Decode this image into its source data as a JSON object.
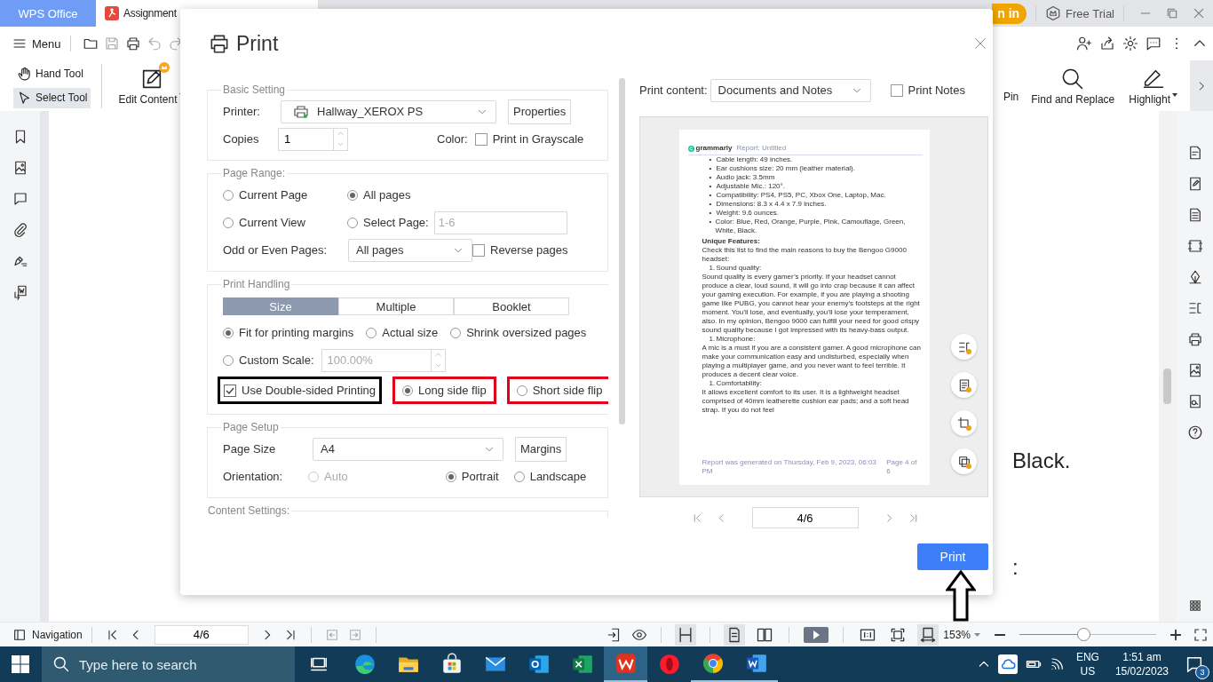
{
  "app_tabs": [
    {
      "label": "WPS Office",
      "kind": "home",
      "selected": false
    },
    {
      "label": "Assignment",
      "kind": "pdf",
      "selected": true
    }
  ],
  "account": {
    "sign_in": "n in",
    "free_trial": "Free Trial"
  },
  "toolbar": {
    "menu": "Menu",
    "tools": [
      {
        "label": "Hand Tool",
        "kind": "hand",
        "selected": false
      },
      {
        "label": "Select Tool",
        "kind": "select",
        "selected": true
      }
    ],
    "edit_content": "Edit Content",
    "pin": "Pin",
    "find_replace": "Find and Replace",
    "highlight": "Highlight"
  },
  "document": {
    "texts": [
      "Black.",
      ":"
    ]
  },
  "dialog": {
    "title": "Print",
    "basic": {
      "legend": "Basic Setting",
      "printer_label": "Printer:",
      "printer": "Hallway_XEROX PS",
      "properties": "Properties",
      "copies_label": "Copies",
      "copies": "1",
      "color_label": "Color:",
      "grayscale": {
        "label": "Print in Grayscale",
        "checked": false
      }
    },
    "page_range": {
      "legend": "Page Range:",
      "options": [
        {
          "label": "Current Page",
          "selected": false
        },
        {
          "label": "All pages",
          "selected": true
        },
        {
          "label": "Current View",
          "selected": false
        },
        {
          "label": "Select Page:",
          "selected": false
        }
      ],
      "select_page_placeholder": "1-6",
      "odd_even_label": "Odd or Even Pages:",
      "odd_even": "All pages",
      "reverse": {
        "label": "Reverse pages",
        "checked": false
      }
    },
    "handling": {
      "legend": "Print Handling",
      "tabs": [
        {
          "label": "Size",
          "selected": true
        },
        {
          "label": "Multiple",
          "selected": false
        },
        {
          "label": "Booklet",
          "selected": false
        }
      ],
      "scales": [
        {
          "label": "Fit for printing margins",
          "selected": true
        },
        {
          "label": "Actual size",
          "selected": false
        },
        {
          "label": "Shrink oversized pages",
          "selected": false
        },
        {
          "label": "Custom Scale:",
          "selected": false
        }
      ],
      "custom_scale": {
        "value": "100.00%",
        "disabled": true
      },
      "double_sided": {
        "label": "Use Double-sided Printing",
        "checked": true
      },
      "flips": [
        {
          "label": "Long side flip",
          "selected": true
        },
        {
          "label": "Short side flip",
          "selected": false
        }
      ]
    },
    "page_setup": {
      "legend": "Page Setup",
      "page_size_label": "Page Size",
      "page_size": "A4",
      "margins": "Margins",
      "orientation_label": "Orientation:",
      "orientations": [
        {
          "label": "Auto",
          "selected": false,
          "disabled": true
        },
        {
          "label": "Portrait",
          "selected": true,
          "disabled": false
        },
        {
          "label": "Landscape",
          "selected": false,
          "disabled": false
        }
      ]
    },
    "content_settings": {
      "legend": "Content Settings:"
    },
    "print_content_label": "Print content:",
    "print_content": "Documents and Notes",
    "print_notes": {
      "label": "Print Notes",
      "checked": false
    },
    "preview": {
      "logo": "grammarly",
      "header": "Report: Untitled",
      "blocks": [
        {
          "kind": "bullet",
          "marker": "•",
          "text": "Cable length: 49 inches."
        },
        {
          "kind": "bullet",
          "marker": "•",
          "text": "Ear cushions size: 20 mm (leather material)."
        },
        {
          "kind": "bullet",
          "marker": "•",
          "text": "Audio jack: 3.5mm"
        },
        {
          "kind": "bullet",
          "marker": "•",
          "text": "Adjustable Mic.: 120°."
        },
        {
          "kind": "bullet",
          "marker": "•",
          "text": "Compatibility: PS4, PS5, PC, Xbox One, Laptop, Mac."
        },
        {
          "kind": "bullet",
          "marker": "•",
          "text": "Dimensions: 8.3 x 4.4 x 7.9 inches."
        },
        {
          "kind": "bullet",
          "marker": "•",
          "text": "Weight: 9.6 ounces."
        },
        {
          "kind": "bullet",
          "marker": "•",
          "text": "Color: Blue, Red, Orange, Purple, Pink, Camouflage, Green, White, Black."
        },
        {
          "kind": "heading",
          "text": "Unique Features:"
        },
        {
          "kind": "para",
          "text": "Check this list to find the main reasons to buy the Bengoo G9000 headset:"
        },
        {
          "kind": "numbered",
          "marker": "1.",
          "text": "Sound quality:"
        },
        {
          "kind": "para",
          "text": "Sound quality is every gamer’s priority. If your headset cannot produce a clear, loud sound, it will go into crap because it can affect your gaming execution. For example, if you are playing a shooting game like PUBG, you cannot hear your enemy’s footsteps at the right moment. You’ll lose, and eventually, you’ll lose your temperament, also. In my opinion, Bengoo 9000 can fulfill your need for good crispy sound quality because I got impressed with its heavy-bass output."
        },
        {
          "kind": "numbered",
          "marker": "1.",
          "text": "Microphone:"
        },
        {
          "kind": "para",
          "text": "A mic is a must if you are a consistent gamer. A good microphone can make your communication easy and undisturbed, especially when playing a multiplayer game, and you never want to feel terrible. It produces a decent clear voice."
        },
        {
          "kind": "numbered",
          "marker": "1.",
          "text": "Comfortability:"
        },
        {
          "kind": "para",
          "text": "It allows excellent comfort to its user. It is a lightweight headset comprised of 40mm leatherette cushion ear pads; and a soft head strap. If you do not feel"
        }
      ],
      "footer": "Report was generated on Thursday, Feb 9, 2023, 06:03 PM",
      "page_label": "Page 4 of 6"
    },
    "page": "4/6",
    "print_button": "Print"
  },
  "status_bar": {
    "navigation": "Navigation",
    "page": "4/6",
    "layout_toggles": [
      {
        "kind": "continuous",
        "selected": true
      }
    ],
    "page_modes": [
      {
        "kind": "single",
        "selected": true
      },
      {
        "kind": "double",
        "selected": false
      }
    ],
    "zoom_modes": [
      {
        "kind": "actual",
        "selected": false
      },
      {
        "kind": "fit-page",
        "selected": false
      },
      {
        "kind": "fit-width",
        "selected": true
      }
    ],
    "zoom": "153%",
    "zoom_slider": {
      "level": 0.47
    }
  },
  "taskbar": {
    "search_placeholder": "Type here to search",
    "apps": [
      {
        "kind": "edge",
        "running": false,
        "selected": false
      },
      {
        "kind": "folder",
        "running": false,
        "selected": false
      },
      {
        "kind": "store",
        "running": false,
        "selected": false
      },
      {
        "kind": "mail",
        "running": false,
        "selected": false
      },
      {
        "kind": "outlook",
        "running": false,
        "selected": false
      },
      {
        "kind": "excel",
        "running": false,
        "selected": false
      },
      {
        "kind": "wps",
        "running": true,
        "selected": true
      },
      {
        "kind": "opera",
        "running": false,
        "selected": false
      },
      {
        "kind": "chrome",
        "running": true,
        "selected": false
      },
      {
        "kind": "word",
        "running": true,
        "selected": false
      }
    ],
    "language": "ENG",
    "region": "US",
    "time": "1:51 am",
    "date": "15/02/2023",
    "notifications": "3"
  }
}
